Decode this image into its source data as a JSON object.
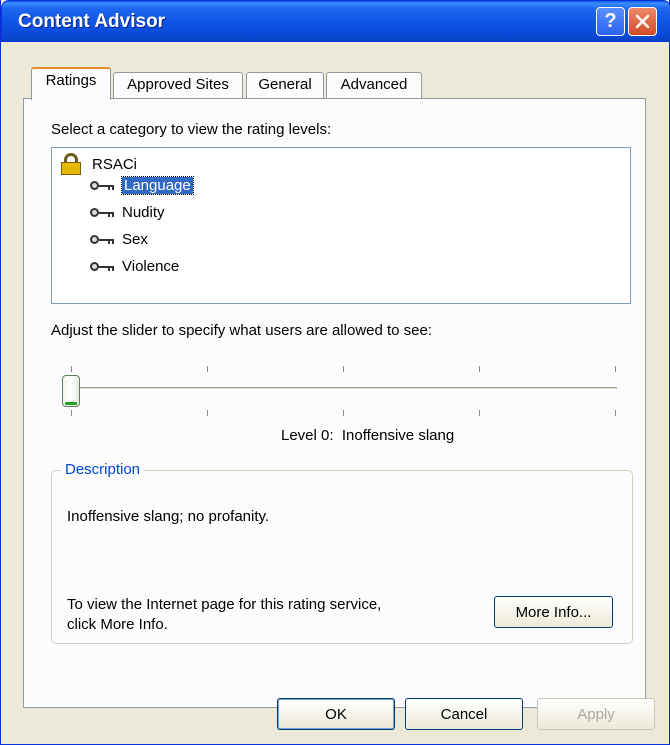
{
  "window": {
    "title": "Content Advisor"
  },
  "tabs": [
    {
      "label": "Ratings"
    },
    {
      "label": "Approved Sites"
    },
    {
      "label": "General"
    },
    {
      "label": "Advanced"
    }
  ],
  "ratings": {
    "category_label": "Select a category to view the rating levels:",
    "tree": {
      "root": "RSACi",
      "items": [
        "Language",
        "Nudity",
        "Sex",
        "Violence"
      ],
      "selected": "Language"
    },
    "slider_label": "Adjust the slider to specify what users are allowed to see:",
    "slider": {
      "level": 0,
      "min": 0,
      "max": 4
    },
    "level_text": "Level 0:  Inoffensive slang",
    "description": {
      "title": "Description",
      "text": "Inoffensive slang; no profanity.",
      "info_line1": "To view the Internet page for this rating service,",
      "info_line2": "click More Info.",
      "more_info_label": "More Info..."
    }
  },
  "buttons": {
    "ok": "OK",
    "cancel": "Cancel",
    "apply": "Apply"
  }
}
